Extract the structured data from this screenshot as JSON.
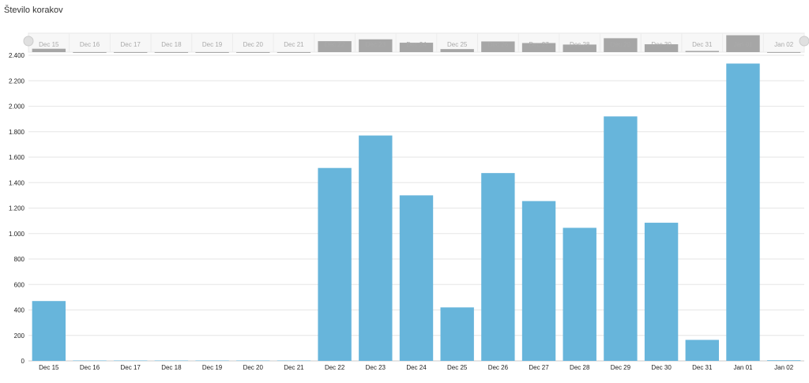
{
  "chart_data": {
    "type": "bar",
    "title": "Število korakov",
    "xlabel": "",
    "ylabel": "",
    "categories": [
      "Dec 15",
      "Dec 16",
      "Dec 17",
      "Dec 18",
      "Dec 19",
      "Dec 20",
      "Dec 21",
      "Dec 22",
      "Dec 23",
      "Dec 24",
      "Dec 25",
      "Dec 26",
      "Dec 27",
      "Dec 28",
      "Dec 29",
      "Dec 30",
      "Dec 31",
      "Jan 01",
      "Jan 02"
    ],
    "values": [
      470,
      3,
      3,
      3,
      3,
      3,
      3,
      1515,
      1770,
      1300,
      420,
      1475,
      1255,
      1045,
      1920,
      1085,
      165,
      2335,
      5
    ],
    "ylim": [
      0,
      2400
    ],
    "yticks": [
      "0",
      "200",
      "400",
      "600",
      "800",
      "1.000",
      "1.200",
      "1.400",
      "1.600",
      "1.800",
      "2.000",
      "2.200",
      "2.400"
    ],
    "grid": true,
    "legend": "none",
    "navigator": true,
    "colors": {
      "bar": "#67b5db",
      "navigator_bar": "#a6a6a6",
      "grid": "#e6e6e6"
    }
  }
}
